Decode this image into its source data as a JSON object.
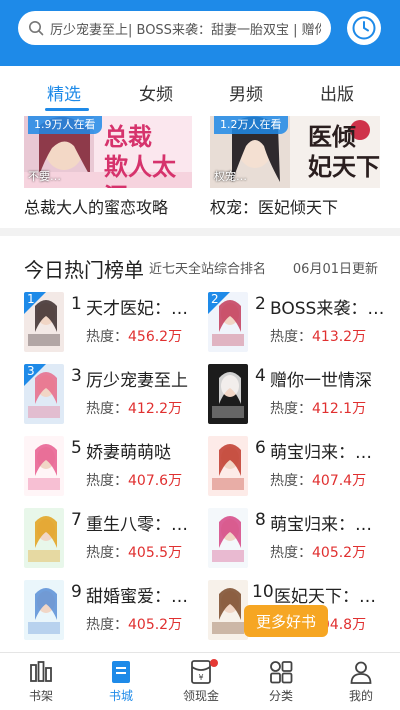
{
  "search": {
    "placeholder_text": "厉少宠妻至上| BOSS来袭：甜妻一胎双宝 | 赠你…",
    "icon": "search-icon",
    "history_icon": "clock-icon"
  },
  "tabs": [
    {
      "label": "精选",
      "active": true
    },
    {
      "label": "女频",
      "active": false
    },
    {
      "label": "男频",
      "active": false
    },
    {
      "label": "出版",
      "active": false
    }
  ],
  "banners": [
    {
      "tag": "1.9万人在看",
      "overlay": "不要…",
      "big_title": "总裁\n欺人太深",
      "caption": "总裁大人的蜜恋攻略"
    },
    {
      "tag": "1.2万人在看",
      "overlay": "权宠…",
      "big_title": "医倾\n妃天下",
      "caption": "权宠：医妃倾天下"
    }
  ],
  "ranking": {
    "title": "今日热门榜单",
    "subtitle": "近七天全站综合排名",
    "updated": "06月01日更新",
    "heat_label": "热度：",
    "items": [
      {
        "rank": "1",
        "title": "天才医妃：…",
        "heat": "456.2万"
      },
      {
        "rank": "2",
        "title": "BOSS来袭：…",
        "heat": "413.2万"
      },
      {
        "rank": "3",
        "title": "厉少宠妻至上",
        "heat": "412.2万"
      },
      {
        "rank": "4",
        "title": "赠你一世情深",
        "heat": "412.1万"
      },
      {
        "rank": "5",
        "title": "娇妻萌萌哒",
        "heat": "407.6万"
      },
      {
        "rank": "6",
        "title": "萌宝归来：…",
        "heat": "407.4万"
      },
      {
        "rank": "7",
        "title": "重生八零：…",
        "heat": "405.5万"
      },
      {
        "rank": "8",
        "title": "萌宝归来：…",
        "heat": "405.2万"
      },
      {
        "rank": "9",
        "title": "甜婚蜜爱：…",
        "heat": "405.2万"
      },
      {
        "rank": "10",
        "title": "医妃天下：…",
        "heat": "404.8万"
      }
    ]
  },
  "more_button": "更多好书",
  "bottom_nav": [
    {
      "label": "书架",
      "icon": "bookshelf-icon",
      "active": false
    },
    {
      "label": "书城",
      "icon": "bookstore-icon",
      "active": true
    },
    {
      "label": "领现金",
      "icon": "red-envelope-icon",
      "active": false,
      "badge": true
    },
    {
      "label": "分类",
      "icon": "category-icon",
      "active": false
    },
    {
      "label": "我的",
      "icon": "profile-icon",
      "active": false
    }
  ],
  "colors": {
    "accent": "#1e8ae8",
    "heat_value": "#e03030",
    "more_button": "#f6a623"
  }
}
